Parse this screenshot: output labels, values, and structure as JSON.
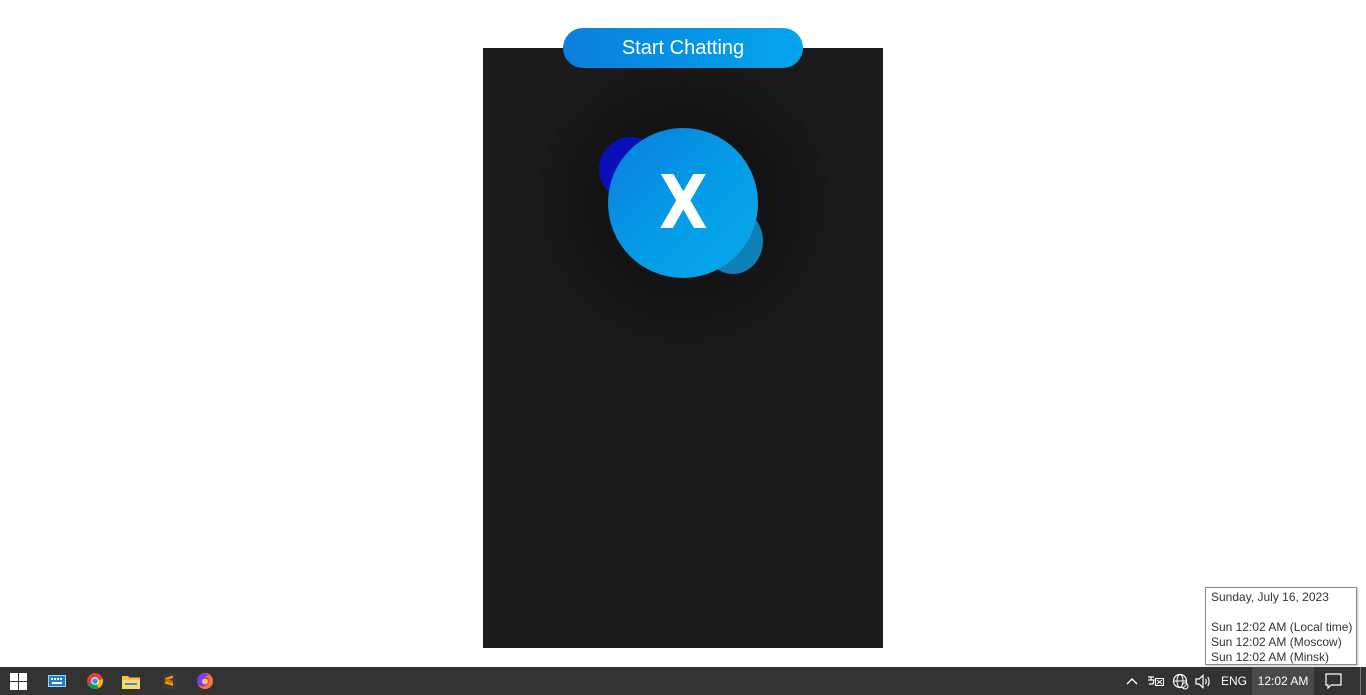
{
  "start_button": {
    "label": "Start Chatting"
  },
  "logo": {
    "letter": "X",
    "accent": "#049de6"
  },
  "clock_flyout": {
    "date": "Sunday, July 16, 2023",
    "zones": [
      {
        "text": "Sun 12:02 AM  (Local time)"
      },
      {
        "text": "Sun 12:02 AM  (Moscow)"
      },
      {
        "text": "Sun 12:02 AM  (Minsk)"
      }
    ]
  },
  "taskbar": {
    "pinned": [
      {
        "name": "start-icon"
      },
      {
        "name": "keyboard-icon"
      },
      {
        "name": "chrome-icon"
      },
      {
        "name": "file-explorer-icon"
      },
      {
        "name": "sublime-text-icon"
      },
      {
        "name": "firefox-icon"
      }
    ],
    "tray": {
      "language": "ENG",
      "time": "12:02 AM"
    }
  },
  "colors": {
    "panel": "#1b1b1d",
    "taskbar": "#333333",
    "button_start": "#0a7fdc",
    "button_end": "#04a6ec"
  }
}
